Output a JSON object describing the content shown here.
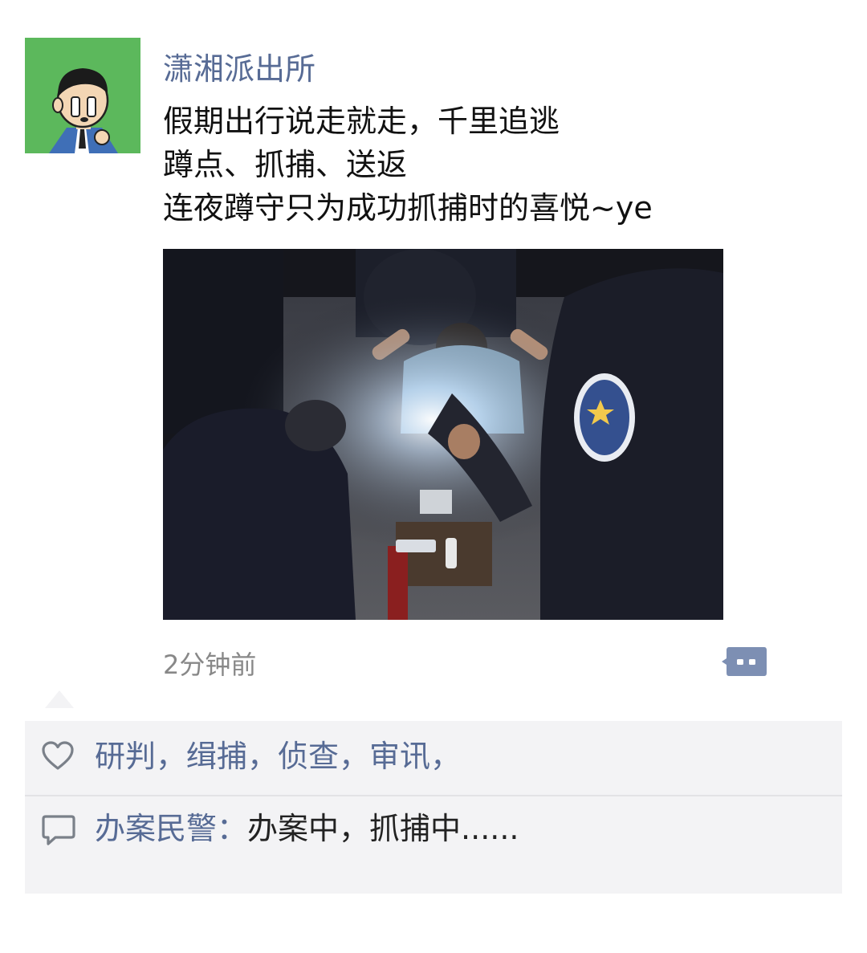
{
  "post": {
    "author": "潇湘派出所",
    "lines": [
      "假期出行说走就走，千里追逃",
      "蹲点、抓捕、送返",
      "连夜蹲守只为成功抓捕时的喜悦~ye"
    ],
    "timestamp": "2分钟前"
  },
  "likes": {
    "text": "研判，缉捕，侦查，审讯，"
  },
  "comment": {
    "author": "办案民警",
    "separator": "：",
    "text": "办案中，抓捕中......"
  },
  "icons": {
    "avatar": "police-cartoon-avatar",
    "like": "heart-outline-icon",
    "comment": "speech-bubble-icon",
    "more": "more-actions-icon"
  },
  "colors": {
    "link": "#576b95",
    "avatar_bg": "#5cb85c",
    "panel_bg": "#f3f3f5",
    "timestamp": "#888888"
  }
}
